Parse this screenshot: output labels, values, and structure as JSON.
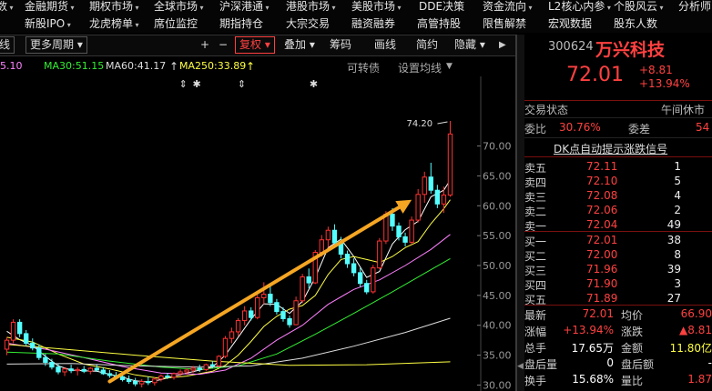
{
  "menu_row1": [
    "数",
    "金融期货",
    "期权市场",
    "全球市场",
    "沪深港通",
    "港股市场",
    "美股市场",
    "DDE决策",
    "资金流向",
    "L2核心内参",
    "个股风云",
    "分析师"
  ],
  "menu_row2": [
    "新股IPO",
    "龙虎榜单",
    "席位监控",
    "期指持仓",
    "大宗交易",
    "融资融券",
    "高管持股",
    "限售解禁",
    "宏观数据",
    "股东人数"
  ],
  "toolbar": {
    "period_left": "线",
    "more_periods": "更多周期",
    "plus": "+",
    "minus": "−",
    "adjust": "复权",
    "overlay": "叠加",
    "chips": "筹码",
    "draw": "画线",
    "simple": "简约",
    "hide": "隐藏"
  },
  "ma_legend": [
    {
      "label": "5.10",
      "color": "#ff80ff"
    },
    {
      "label": "MA30:51.15",
      "color": "#33ee33"
    },
    {
      "label": "MA60:41.17",
      "color": "#dddddd"
    },
    {
      "label": "MA250:33.89",
      "color": "#ffff44"
    },
    {
      "label": "可转债",
      "color": "#aaaaaa"
    },
    {
      "label": "设置均线",
      "color": "#aaaaaa"
    }
  ],
  "chart_data": {
    "type": "candlestick",
    "y_ticks": [
      "70.00",
      "65.00",
      "60.00",
      "55.00",
      "50.00",
      "45.00",
      "40.00",
      "35.00",
      "30.00"
    ],
    "ylim": [
      29,
      78
    ],
    "peak_label": "74.20",
    "candles": [
      [
        36,
        38,
        35,
        37.5
      ],
      [
        37.5,
        41,
        37,
        40.5
      ],
      [
        40.5,
        41,
        38,
        38.6
      ],
      [
        38.6,
        39.2,
        36.5,
        37
      ],
      [
        37,
        37.8,
        35.8,
        36.2
      ],
      [
        36.2,
        36.8,
        34.2,
        34.6
      ],
      [
        34.6,
        35.2,
        33.2,
        33.8
      ],
      [
        33.8,
        34.4,
        32.6,
        33
      ],
      [
        33,
        33.6,
        31.8,
        32.2
      ],
      [
        32.2,
        33,
        31.5,
        32.7
      ],
      [
        32.7,
        33.4,
        32,
        32.4
      ],
      [
        32.4,
        33,
        31.6,
        32.6
      ],
      [
        32.6,
        33.2,
        32,
        32.3
      ],
      [
        32.3,
        33,
        31.8,
        32.8
      ],
      [
        32.8,
        33.4,
        32.2,
        32.5
      ],
      [
        32.5,
        33,
        31.7,
        31.9
      ],
      [
        31.9,
        32.5,
        31.2,
        31.6
      ],
      [
        31.6,
        32.2,
        31,
        31.4
      ],
      [
        31.4,
        32,
        30.6,
        30.9
      ],
      [
        30.9,
        31.6,
        30.2,
        30.6
      ],
      [
        30.6,
        31.2,
        29.8,
        30.2
      ],
      [
        30.2,
        31,
        29.6,
        30.6
      ],
      [
        30.6,
        31.4,
        30,
        30.4
      ],
      [
        30.4,
        31.3,
        29.9,
        31
      ],
      [
        31,
        31.8,
        30.6,
        31.5
      ],
      [
        31.5,
        32,
        31,
        31.3
      ],
      [
        31.3,
        32.1,
        30.9,
        31.9
      ],
      [
        31.9,
        32.6,
        31.4,
        32.2
      ],
      [
        32.2,
        32.8,
        31.7,
        32.5
      ],
      [
        32.5,
        33.2,
        32,
        32.8
      ],
      [
        32.8,
        33.4,
        32.2,
        32.6
      ],
      [
        32.6,
        33.6,
        32.3,
        33.4
      ],
      [
        33.4,
        34,
        32.8,
        33.2
      ],
      [
        33.2,
        35,
        33,
        34.8
      ],
      [
        34.8,
        38.2,
        34.5,
        37.8
      ],
      [
        37.8,
        39.6,
        37,
        38.9
      ],
      [
        38.9,
        41.2,
        38.2,
        40.8
      ],
      [
        40.8,
        43.2,
        40,
        42.4
      ],
      [
        42.4,
        43,
        40.8,
        41.3
      ],
      [
        41.3,
        45.1,
        41,
        44.6
      ],
      [
        44.6,
        47.2,
        43.5,
        45.2
      ],
      [
        45.2,
        46.5,
        43.2,
        43.8
      ],
      [
        43.8,
        44.4,
        41.8,
        42.3
      ],
      [
        42.3,
        43,
        40.6,
        41.1
      ],
      [
        41.1,
        41.6,
        39.6,
        40.1
      ],
      [
        40.1,
        44.8,
        40,
        44.1
      ],
      [
        44.1,
        48.6,
        43.7,
        48.1
      ],
      [
        48.1,
        49.5,
        46.2,
        47.1
      ],
      [
        47.1,
        52.6,
        46.9,
        52.2
      ],
      [
        52.2,
        55.1,
        51.5,
        54.3
      ],
      [
        54.3,
        56.5,
        53,
        55.9
      ],
      [
        55.9,
        56.9,
        53.2,
        53.8
      ],
      [
        53.8,
        54.8,
        51.2,
        51.9
      ],
      [
        51.9,
        52.5,
        49.6,
        50.3
      ],
      [
        50.3,
        51.2,
        48.2,
        48.8
      ],
      [
        48.8,
        49.6,
        46.4,
        47
      ],
      [
        47,
        47.6,
        45.2,
        45.6
      ],
      [
        45.6,
        50.1,
        45.3,
        49.6
      ],
      [
        49.6,
        54.6,
        49.4,
        54.1
      ],
      [
        54.1,
        59.1,
        53.6,
        58.6
      ],
      [
        58.6,
        59.6,
        55.8,
        56.6
      ],
      [
        56.6,
        57.2,
        54.2,
        54.8
      ],
      [
        54.8,
        55.5,
        53.2,
        53.9
      ],
      [
        53.9,
        58.2,
        53.5,
        57.6
      ],
      [
        57.6,
        62.8,
        57.2,
        61.9
      ],
      [
        61.9,
        65.7,
        60.5,
        64.8
      ],
      [
        64.8,
        67.2,
        62,
        62.6
      ],
      [
        62.6,
        63.5,
        59.6,
        60.3
      ],
      [
        60.3,
        63.2,
        58.8,
        61.8
      ],
      [
        61.8,
        74.2,
        61.5,
        72.01
      ]
    ],
    "mas": [
      {
        "name": "MA5",
        "color": "#ffffff",
        "points": [
          [
            0,
            39
          ],
          [
            2,
            37.6
          ],
          [
            4,
            36.6
          ],
          [
            6,
            34.8
          ],
          [
            8,
            33.2
          ],
          [
            10,
            32.5
          ],
          [
            12,
            32.4
          ],
          [
            14,
            32.3
          ],
          [
            16,
            31.8
          ],
          [
            18,
            31.3
          ],
          [
            20,
            30.7
          ],
          [
            22,
            30.5
          ],
          [
            24,
            30.9
          ],
          [
            26,
            31.5
          ],
          [
            28,
            32
          ],
          [
            30,
            32.5
          ],
          [
            32,
            33
          ],
          [
            34,
            35
          ],
          [
            36,
            38
          ],
          [
            38,
            41
          ],
          [
            40,
            43.6
          ],
          [
            42,
            43.5
          ],
          [
            44,
            42
          ],
          [
            46,
            44
          ],
          [
            48,
            48
          ],
          [
            50,
            53
          ],
          [
            52,
            54.4
          ],
          [
            54,
            51.5
          ],
          [
            56,
            48
          ],
          [
            58,
            49
          ],
          [
            60,
            53.6
          ],
          [
            62,
            56
          ],
          [
            64,
            57.4
          ],
          [
            66,
            61.5
          ],
          [
            68,
            62.6
          ],
          [
            69,
            64.3
          ]
        ]
      },
      {
        "name": "MA10",
        "color": "#ffff44",
        "points": [
          [
            0,
            38
          ],
          [
            4,
            37.2
          ],
          [
            8,
            35.2
          ],
          [
            12,
            33.5
          ],
          [
            16,
            32.7
          ],
          [
            20,
            31.7
          ],
          [
            24,
            31.1
          ],
          [
            28,
            31.5
          ],
          [
            32,
            32.3
          ],
          [
            34,
            33.3
          ],
          [
            36,
            35
          ],
          [
            38,
            37.3
          ],
          [
            40,
            39.8
          ],
          [
            42,
            41.5
          ],
          [
            44,
            42.7
          ],
          [
            46,
            43.3
          ],
          [
            48,
            45
          ],
          [
            50,
            48.5
          ],
          [
            52,
            51
          ],
          [
            54,
            51.5
          ],
          [
            56,
            51
          ],
          [
            58,
            50.5
          ],
          [
            60,
            51.5
          ],
          [
            62,
            53
          ],
          [
            64,
            54
          ],
          [
            66,
            57
          ],
          [
            68,
            59.5
          ],
          [
            69,
            61
          ]
        ]
      },
      {
        "name": "MA20",
        "color": "#ff80ff",
        "points": [
          [
            0,
            37
          ],
          [
            6,
            36
          ],
          [
            12,
            34.6
          ],
          [
            18,
            33.1
          ],
          [
            24,
            32
          ],
          [
            30,
            31.8
          ],
          [
            34,
            32.5
          ],
          [
            38,
            34.5
          ],
          [
            42,
            37.5
          ],
          [
            46,
            40
          ],
          [
            50,
            43.5
          ],
          [
            54,
            46
          ],
          [
            58,
            47.6
          ],
          [
            62,
            50
          ],
          [
            66,
            52.7
          ],
          [
            69,
            55.2
          ]
        ]
      },
      {
        "name": "MA30",
        "color": "#33ee33",
        "points": [
          [
            0,
            35.5
          ],
          [
            8,
            35.2
          ],
          [
            16,
            34
          ],
          [
            24,
            33
          ],
          [
            30,
            32.6
          ],
          [
            36,
            33.2
          ],
          [
            42,
            35.2
          ],
          [
            48,
            38.5
          ],
          [
            54,
            42
          ],
          [
            60,
            45.6
          ],
          [
            66,
            49.3
          ],
          [
            69,
            51.15
          ]
        ]
      },
      {
        "name": "MA60",
        "color": "#dddddd",
        "points": [
          [
            0,
            33.5
          ],
          [
            10,
            33.6
          ],
          [
            20,
            33.2
          ],
          [
            30,
            33
          ],
          [
            38,
            33.2
          ],
          [
            46,
            34.5
          ],
          [
            54,
            36.5
          ],
          [
            62,
            38.8
          ],
          [
            69,
            41.17
          ]
        ]
      },
      {
        "name": "MA250",
        "color": "#ffff44",
        "points": [
          [
            0,
            36.8
          ],
          [
            20,
            35
          ],
          [
            32,
            34
          ],
          [
            44,
            33.3
          ],
          [
            56,
            33.4
          ],
          [
            69,
            33.89
          ]
        ]
      }
    ],
    "markers": [
      "⇕",
      "✱",
      "⇕",
      "✱"
    ],
    "trend_arrow": {
      "from": [
        16,
        30.6
      ],
      "to": [
        63,
        61
      ],
      "color": "#f5a623"
    }
  },
  "quote": {
    "code": "300624",
    "name": "万兴科技",
    "price": "72.01",
    "change": "+8.81",
    "change_pct": "+13.94%",
    "status_label": "交易状态",
    "status_value": "午间休市",
    "ratio_label": "委比",
    "ratio_value": "30.76%",
    "diff_label": "委差",
    "diff_value": "54",
    "signal": "DK点自动提示涨跌信号",
    "asks": [
      {
        "label": "卖五",
        "price": "72.11",
        "vol": "1"
      },
      {
        "label": "卖四",
        "price": "72.10",
        "vol": "5"
      },
      {
        "label": "卖三",
        "price": "72.08",
        "vol": "4"
      },
      {
        "label": "卖二",
        "price": "72.06",
        "vol": "2"
      },
      {
        "label": "卖一",
        "price": "72.04",
        "vol": "49"
      }
    ],
    "bids": [
      {
        "label": "买一",
        "price": "72.01",
        "vol": "38"
      },
      {
        "label": "买二",
        "price": "72.00",
        "vol": "8"
      },
      {
        "label": "买三",
        "price": "71.96",
        "vol": "39"
      },
      {
        "label": "买四",
        "price": "71.90",
        "vol": "3"
      },
      {
        "label": "买五",
        "price": "71.89",
        "vol": "27"
      }
    ],
    "stats": [
      {
        "l1": "最新",
        "v1": "72.01",
        "c1": "#ff4040",
        "l2": "均价",
        "v2": "66.90",
        "c2": "#ff4040"
      },
      {
        "l1": "涨幅",
        "v1": "+13.94%",
        "c1": "#ff4040",
        "l2": "涨跌",
        "v2": "▲8.81",
        "c2": "#ff4040"
      },
      {
        "l1": "总手",
        "v1": "17.65万",
        "c1": "#ffffff",
        "l2": "金额",
        "v2": "11.80亿",
        "c2": "#ffff44"
      },
      {
        "l1": "盘后量",
        "v1": "0",
        "c1": "#ffffff",
        "l2": "盘后额",
        "v2": "-",
        "c2": "#ffffff"
      },
      {
        "l1": "换手",
        "v1": "15.68%",
        "c1": "#ffffff",
        "l2": "量比",
        "v2": "1.87",
        "c2": "#ff4040"
      }
    ]
  }
}
